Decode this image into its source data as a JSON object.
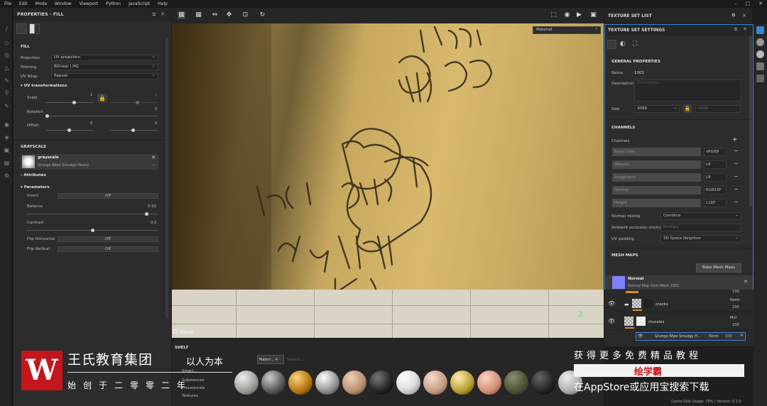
{
  "menu": [
    "File",
    "Edit",
    "Mode",
    "Window",
    "Viewport",
    "Python",
    "JavaScript",
    "Help"
  ],
  "properties": {
    "title": "PROPERTIES - FILL",
    "section": "FILL",
    "projection_label": "Projection",
    "projection_value": "UV projection",
    "filtering_label": "Filtering",
    "filtering_value": "Bilinear | HQ",
    "uvwrap_label": "UV Wrap",
    "uvwrap_value": "Repeat",
    "uvtrans_label": "UV transformations",
    "scale_label": "Scale",
    "scale_value": "1",
    "scale_value2": "1",
    "rotation_label": "Rotation",
    "rotation_value": "0",
    "offset_label": "Offset",
    "offset_value1": "0",
    "offset_value2": "0",
    "grayscale_section": "GRAYSCALE",
    "grayscale_name": "grayscale",
    "grayscale_resource": "Grunge Wipe Smudgy Heavy",
    "attributes_label": "Attributes",
    "parameters_label": "Parameters",
    "invert_label": "Invert",
    "invert_value": "Off",
    "balance_label": "Balance",
    "balance_value": "0.92",
    "contrast_label": "Contrast",
    "contrast_value": "0.5",
    "fliph_label": "Flip Horizontal",
    "fliph_value": "Off",
    "flipv_label": "Flip Vertical",
    "flipv_value": "Off"
  },
  "viewport": {
    "material_mode": "Material",
    "mask_label": "MASK"
  },
  "texture_set_list": {
    "title": "TEXTURE SET LIST"
  },
  "texture_set_settings": {
    "title": "TEXTURE SET SETTINGS",
    "general": "GENERAL PROPERTIES",
    "name_label": "Name",
    "name_value": "1001",
    "description_label": "Description",
    "description_placeholder": "Description",
    "size_label": "Size",
    "size_value": "4096",
    "size_value2": "4096",
    "channels_section": "CHANNELS",
    "channels_label": "Channels",
    "channels": [
      {
        "name": "Base Color",
        "format": "sRGB8"
      },
      {
        "name": "Metallic",
        "format": "L8"
      },
      {
        "name": "Roughness",
        "format": "L8"
      },
      {
        "name": "Normal",
        "format": "RGB16F"
      },
      {
        "name": "Height",
        "format": "L16F"
      }
    ],
    "normal_mixing_label": "Normal mixing",
    "normal_mixing_value": "Combine",
    "ao_mixing_label": "Ambient occlusion mixing",
    "ao_mixing_value": "Multiply",
    "uv_padding_label": "UV padding",
    "uv_padding_value": "3D Space Neighbor",
    "mesh_maps": "MESH MAPS",
    "bake_button": "Bake Mesh Maps",
    "normal_map_name": "Normal",
    "normal_map_source": "Normal Map from Mesh 1001"
  },
  "layers": [
    {
      "name": "cracks",
      "blend": "Norm",
      "opacity": "100"
    },
    {
      "name": "murales",
      "blend": "Mul",
      "opacity": "100"
    }
  ],
  "layer_effect": {
    "name": "Grunge Wipe Smudgy H...",
    "blend": "Norm",
    "opacity": "100"
  },
  "layer_top_opacity": "100",
  "shelf": {
    "title": "SHELF",
    "tab": "Materi...",
    "search_placeholder": "Search...",
    "categories": [
      "Smart...",
      "Substances",
      "Procedurals",
      "Textures"
    ]
  },
  "watermark": {
    "title": "王氏教育集团",
    "slogan": "以人为本",
    "sub": "始创于二零零二年",
    "right_line1": "获得更多免费精品教程",
    "badge": "绘学霸",
    "right_line2": "在AppStore或应用宝搜索下载"
  },
  "status": "Cache Disk Usage:  75% | Version: 6.1.0",
  "colors": {
    "accent": "#3a84d6",
    "brand_red": "#c4161c",
    "normal_swatch": "#8080ff"
  }
}
